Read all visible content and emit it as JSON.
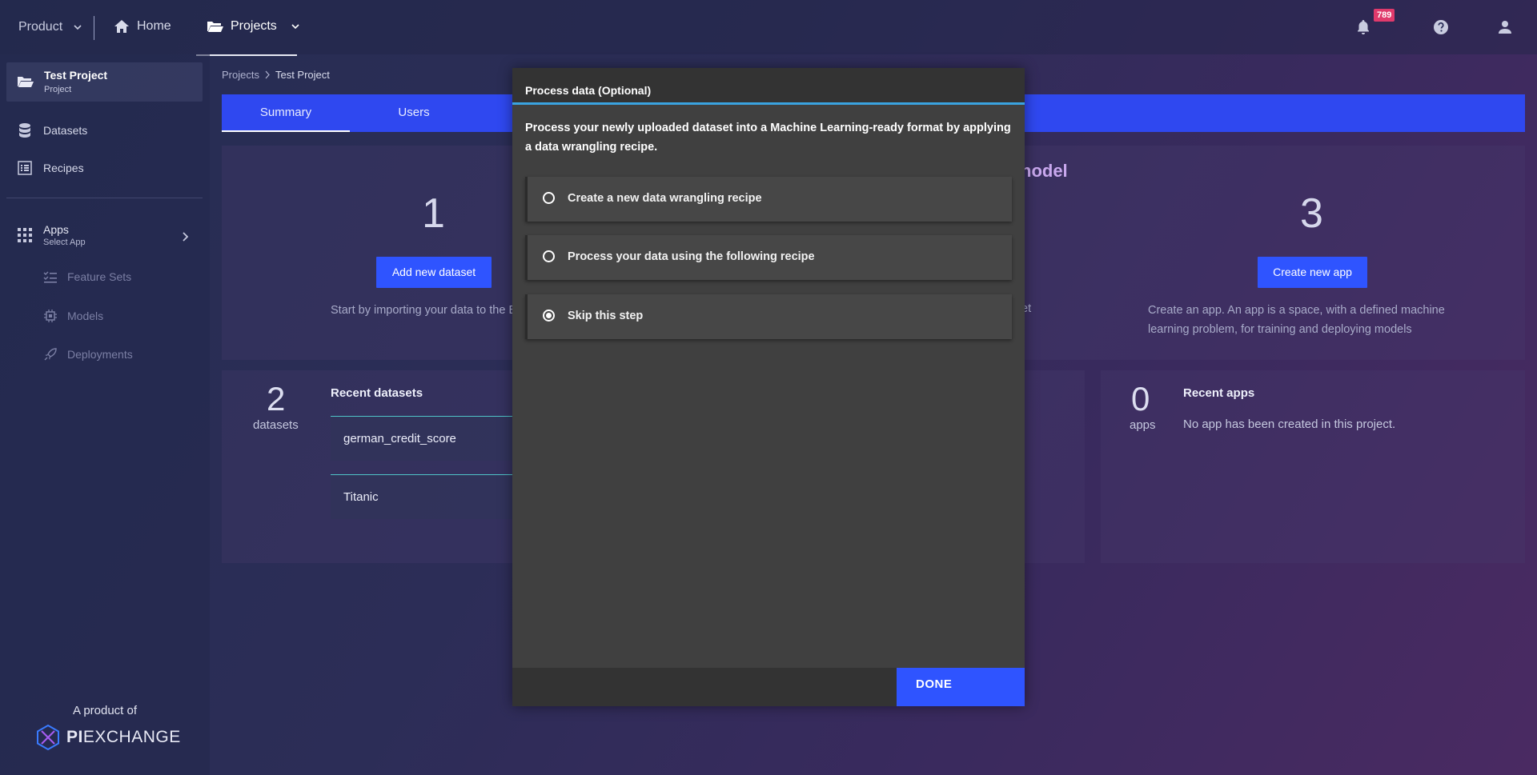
{
  "nav": {
    "product": "Product",
    "home": "Home",
    "projects": "Projects",
    "notification_count": "789"
  },
  "sidebar": {
    "project_title": "Test Project",
    "project_sub": "Project",
    "items": [
      {
        "label": "Datasets",
        "icon": "database-icon"
      },
      {
        "label": "Recipes",
        "icon": "list-icon"
      }
    ],
    "apps_title": "Apps",
    "apps_sub": "Select App",
    "sub_items": [
      {
        "label": "Feature Sets",
        "icon": "checklist-icon"
      },
      {
        "label": "Models",
        "icon": "chip-icon"
      },
      {
        "label": "Deployments",
        "icon": "rocket-icon"
      }
    ],
    "footer": "A product of",
    "logo_left": "PI",
    "logo_right": "EXCHANGE"
  },
  "breadcrumb": {
    "root": "Projects",
    "current": "Test Project"
  },
  "tabs": [
    "Summary",
    "Users"
  ],
  "summary": {
    "step1_number": "1",
    "step1_button": "Add new dataset",
    "step1_desc": "Start by importing your data to the En",
    "step2_title_fragment": "nodel",
    "step2_desc_fragment": "et",
    "step3_number": "3",
    "step3_button": "Create new app",
    "step3_desc": "Create an app. An app is a space, with a defined machine learning problem, for training and deploying models"
  },
  "datasets_panel": {
    "count": "2",
    "count_label": "datasets",
    "title": "Recent datasets",
    "rows": [
      "german_credit_score",
      "Titanic"
    ]
  },
  "apps_panel": {
    "count": "0",
    "count_label": "apps",
    "title": "Recent apps",
    "empty": "No app has been created in this project."
  },
  "modal": {
    "title": "Process data (Optional)",
    "description": "Process your newly uploaded dataset into a Machine Learning-ready format by applying a data wrangling recipe.",
    "options": [
      {
        "label": "Create a new data wrangling recipe",
        "selected": false
      },
      {
        "label": "Process your data using the following recipe",
        "selected": false
      },
      {
        "label": "Skip this step",
        "selected": true
      }
    ],
    "done": "DONE"
  },
  "colors": {
    "accent": "#2f54ff",
    "tabbar": "#2f48f0",
    "badge": "#e03a6c"
  }
}
